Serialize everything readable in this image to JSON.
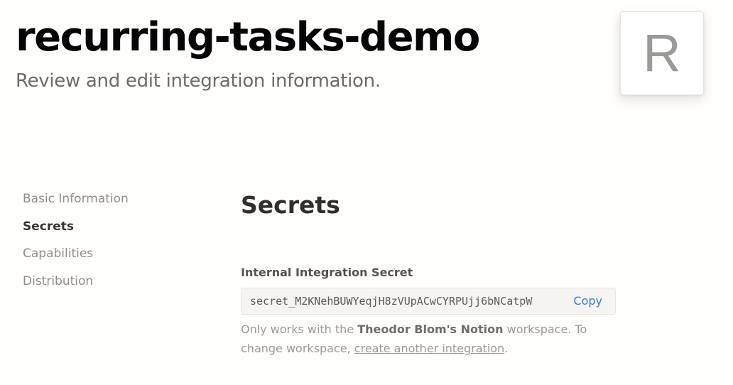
{
  "header": {
    "title": "recurring-tasks-demo",
    "subtitle": "Review and edit integration information.",
    "avatar_letter": "R"
  },
  "sidebar": {
    "items": [
      {
        "label": "Basic Information",
        "active": false
      },
      {
        "label": "Secrets",
        "active": true
      },
      {
        "label": "Capabilities",
        "active": false
      },
      {
        "label": "Distribution",
        "active": false
      }
    ]
  },
  "secrets": {
    "section_title": "Secrets",
    "field_label": "Internal Integration Secret",
    "secret_value": "secret_M2KNehBUWYeqjH8zVUpACwCYRPUjj6bNCatpW",
    "copy_label": "Copy",
    "help": {
      "prefix": "Only works with the ",
      "workspace_name": "Theodor Blom's Notion",
      "middle": " workspace. To change workspace, ",
      "link_text": "create another integration",
      "suffix": "."
    }
  },
  "colors": {
    "background": "#fffefc",
    "title": "#050505",
    "muted_text": "#9b9a97",
    "link_blue": "#3f7ac8"
  }
}
